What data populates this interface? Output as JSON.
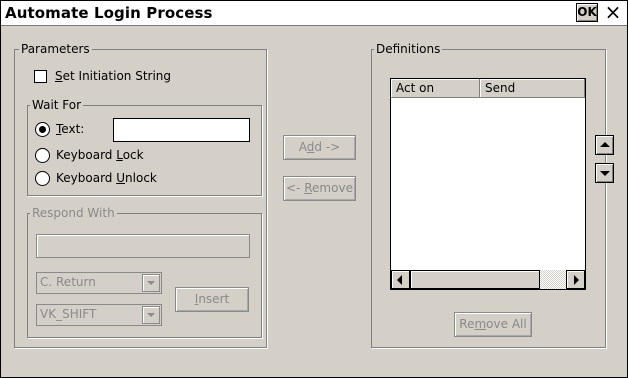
{
  "window": {
    "title": "Automate Login Process",
    "ok_label": "OK",
    "close_glyph": "×"
  },
  "parameters": {
    "legend": "Parameters",
    "set_initiation_string": {
      "pre": "",
      "accel": "S",
      "post": "et Initiation String",
      "checked": false
    },
    "wait_for": {
      "legend": "Wait For",
      "text_option": {
        "pre": "",
        "accel": "T",
        "post": "ext:",
        "checked": true
      },
      "text_value": "",
      "keyboard_lock": {
        "pre": "Keyboard ",
        "accel": "L",
        "post": "ock",
        "checked": false
      },
      "keyboard_unlock": {
        "pre": "Keyboard ",
        "accel": "U",
        "post": "nlock",
        "checked": false
      }
    },
    "respond_with": {
      "legend": "Respond With",
      "value": "",
      "key_combo": "C. Return",
      "modifier_combo": "VK_SHIFT",
      "insert": {
        "pre": "",
        "accel": "I",
        "post": "nsert"
      }
    }
  },
  "actions": {
    "add": {
      "pre": "A",
      "accel": "d",
      "post": "d ->"
    },
    "remove": {
      "pre": "<- ",
      "accel": "R",
      "post": "emove"
    }
  },
  "definitions": {
    "legend": "Definitions",
    "columns": [
      "Act on",
      "Send"
    ],
    "rows": [],
    "remove_all": {
      "pre": "Re",
      "accel": "m",
      "post": "ove All"
    }
  },
  "icons": {
    "scroll_left": "scroll-left-icon",
    "scroll_right": "scroll-right-icon",
    "move_up": "move-up-icon",
    "move_down": "move-down-icon"
  },
  "colors": {
    "dialog_bg": "#d4d0c8",
    "title_bg": "#ffffff",
    "disabled_text": "#8a8a8a"
  }
}
